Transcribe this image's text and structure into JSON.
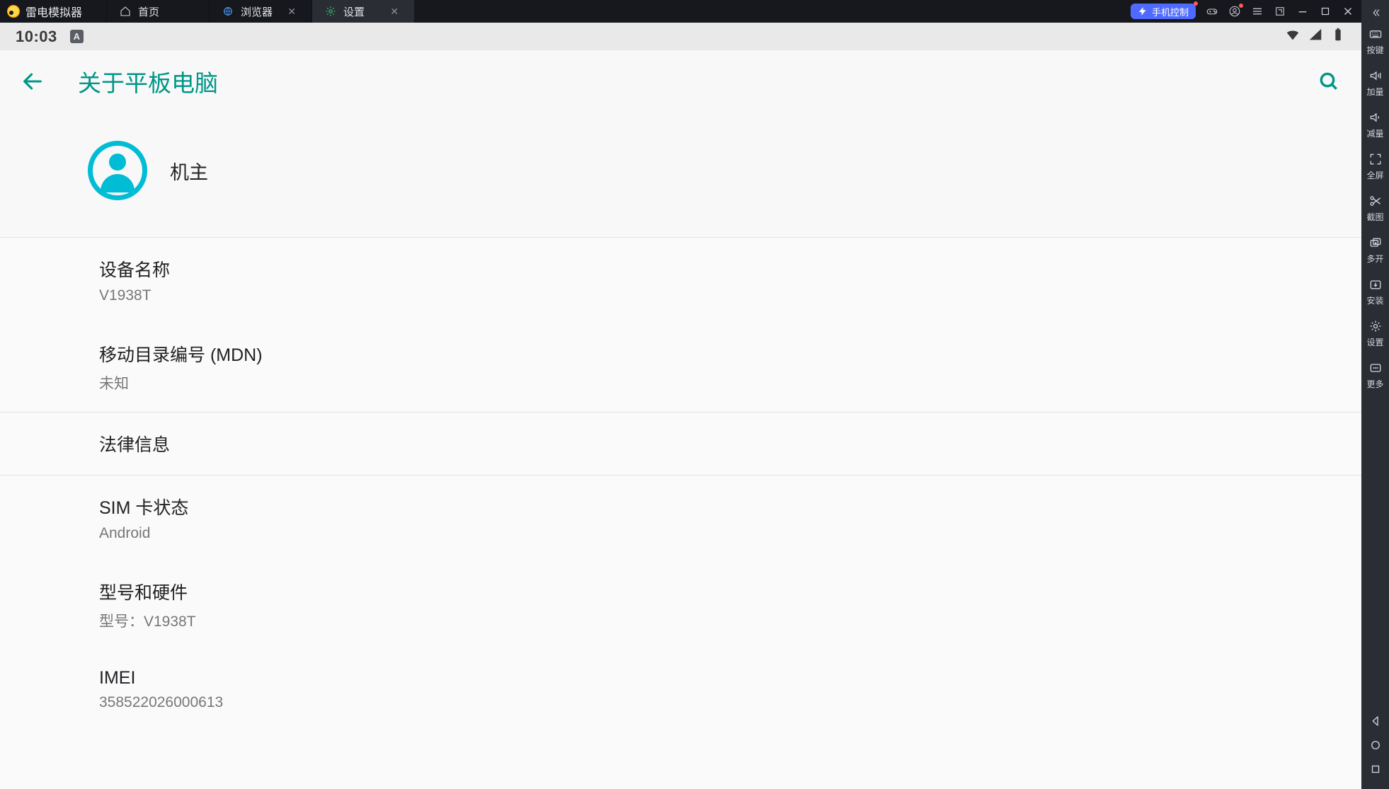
{
  "titlebar": {
    "app_name": "雷电模拟器",
    "tabs": [
      {
        "label": "首页",
        "icon": "home-icon",
        "closable": false
      },
      {
        "label": "浏览器",
        "icon": "globe-icon",
        "closable": true
      },
      {
        "label": "设置",
        "icon": "settings-icon",
        "closable": true,
        "active": true
      }
    ],
    "phone_control": "手机控制"
  },
  "sidebar": {
    "items": [
      {
        "label": "按键",
        "icon": "keyboard-icon"
      },
      {
        "label": "加量",
        "icon": "volume-up-icon"
      },
      {
        "label": "减量",
        "icon": "volume-down-icon"
      },
      {
        "label": "全屏",
        "icon": "fullscreen-icon"
      },
      {
        "label": "截图",
        "icon": "scissors-icon"
      },
      {
        "label": "多开",
        "icon": "multi-instance-icon"
      },
      {
        "label": "安装",
        "icon": "install-icon"
      },
      {
        "label": "设置",
        "icon": "gear-icon"
      },
      {
        "label": "更多",
        "icon": "more-icon"
      }
    ]
  },
  "status": {
    "time": "10:03",
    "badge": "A"
  },
  "appbar": {
    "title": "关于平板电脑"
  },
  "profile": {
    "owner": "机主"
  },
  "rows": [
    {
      "title": "设备名称",
      "sub": "V1938T",
      "div": false
    },
    {
      "title": "移动目录编号 (MDN)",
      "sub": "未知",
      "div": true
    },
    {
      "title": "法律信息",
      "sub": null,
      "div": true
    },
    {
      "title": "SIM 卡状态",
      "sub": "Android",
      "div": false
    },
    {
      "title": "型号和硬件",
      "sub": "型号：V1938T",
      "div": false
    },
    {
      "title": "IMEI",
      "sub": "358522026000613",
      "div": false
    }
  ]
}
